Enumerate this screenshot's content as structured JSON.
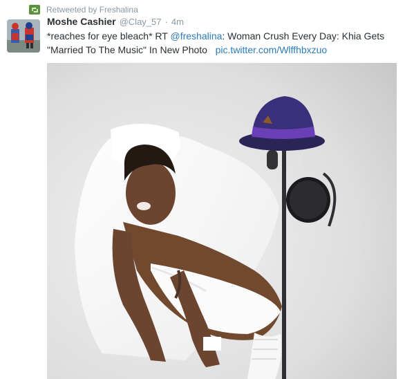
{
  "context": {
    "icon": "retweet-icon",
    "text": "Retweeted by Freshalina"
  },
  "tweet": {
    "avatar_icon": "user-avatar",
    "fullname": "Moshe Cashier",
    "username": "@Clay_57",
    "separator": "·",
    "time": "4m",
    "text_part1": "*reaches for eye bleach* RT ",
    "mention": "@freshalina",
    "text_part2": ": Woman Crush Every Day: Khia Gets",
    "text_part3": "\"Married To The Music\" In New Photo",
    "media_link": "pic.twitter.com/Wlffhbxzuo",
    "photo_icon": "attached-photo"
  },
  "colors": {
    "link": "#2b7bb9",
    "retweet": "#5c913b",
    "meta": "#8899a6",
    "text": "#292f33"
  }
}
